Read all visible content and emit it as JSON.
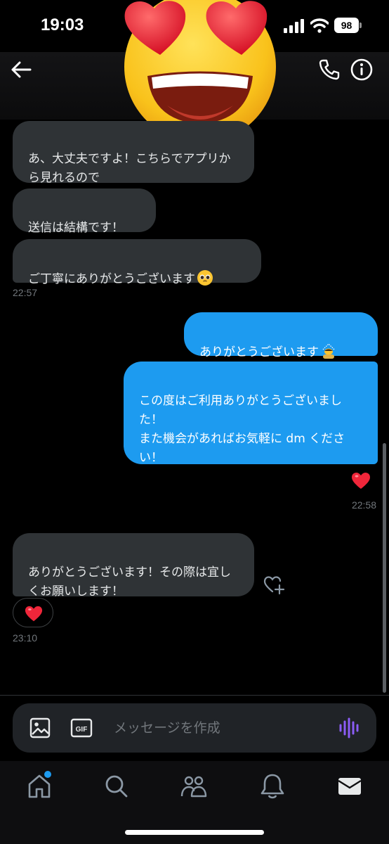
{
  "status_bar": {
    "time": "19:03",
    "battery": "98"
  },
  "header": {
    "back_icon": "arrow-left-icon",
    "call_icon": "phone-icon",
    "info_icon": "info-icon",
    "sticker": "heart-eyes-face-emoji"
  },
  "messages": [
    {
      "direction": "incoming",
      "text": "あ、大丈夫ですよ！こちらでアプリから見れるので"
    },
    {
      "direction": "incoming",
      "text": "送信は結構です！"
    },
    {
      "direction": "incoming",
      "text": "ご丁寧にありがとうございます",
      "emoji": "pleading-face-emoji"
    },
    {
      "direction": "outgoing",
      "text": "ありがとうございます",
      "emoji": "bowing-person-emoji"
    },
    {
      "direction": "outgoing",
      "text": "この度はご利用ありがとうございました！\nまた機会があればお気軽に dm ください！",
      "reaction": "red-heart-emoji"
    },
    {
      "direction": "incoming",
      "text": "ありがとうございます！その際は宜しくお願いします！",
      "reaction": "red-heart-emoji"
    }
  ],
  "timestamps": [
    "22:57",
    "22:58",
    "23:10"
  ],
  "composer": {
    "placeholder": "メッセージを作成",
    "image_icon": "image-icon",
    "gif_icon": "gif-icon",
    "voice_icon": "voice-wave-icon"
  },
  "tabbar": {
    "items": [
      "home-icon",
      "search-icon",
      "community-icon",
      "notification-bell-icon",
      "mail-icon"
    ]
  },
  "colors": {
    "accent": "#1d9bf0",
    "incoming_bubble": "#2f3336",
    "voice_accent": "#8b5cf6"
  }
}
